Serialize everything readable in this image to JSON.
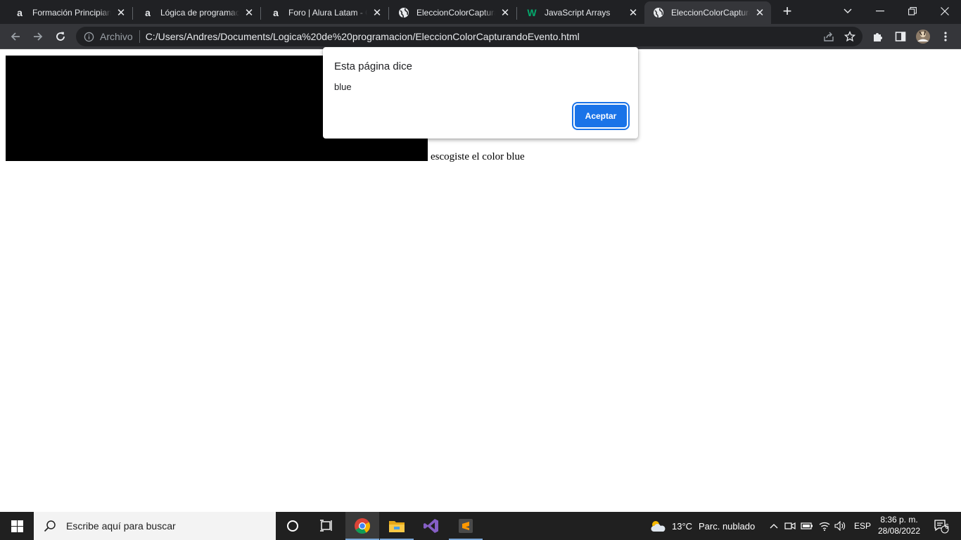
{
  "browser": {
    "tabs": [
      {
        "title": "Formación Principiante",
        "favicon": "alura-a-icon",
        "glyph": "a"
      },
      {
        "title": "Lógica de programación",
        "favicon": "alura-a-icon",
        "glyph": "a"
      },
      {
        "title": "Foro | Alura Latam - Cursos",
        "favicon": "alura-a-icon",
        "glyph": "a"
      },
      {
        "title": "EleccionColorCapturando",
        "favicon": "globe-icon",
        "glyph": ""
      },
      {
        "title": "JavaScript Arrays",
        "favicon": "w3schools-icon",
        "glyph": "W"
      },
      {
        "title": "EleccionColorCapturando",
        "favicon": "globe-icon",
        "glyph": "",
        "active": true
      }
    ],
    "new_tab": "+",
    "window_controls": {
      "tab_search": "⌄",
      "minimize": "—",
      "restore": "❐",
      "close": "✕"
    },
    "omnibox": {
      "chip": "Archivo",
      "url": "C:/Users/Andres/Documents/Logica%20de%20programacion/EleccionColorCapturandoEvento.html"
    }
  },
  "page": {
    "chosen_text": "escogiste el color blue"
  },
  "dialog": {
    "title": "Esta página dice",
    "message": "blue",
    "ok_label": "Aceptar"
  },
  "taskbar": {
    "search_placeholder": "Escribe aquí para buscar",
    "weather_temp": "13°C",
    "weather_desc": "Parc. nublado",
    "language": "ESP",
    "time": "8:36 p. m.",
    "date": "28/08/2022",
    "notifications_count": "6"
  },
  "colors": {
    "tab_strip": "#202124",
    "toolbar": "#35363a",
    "accent_blue": "#1a73e8",
    "taskbar": "#202020"
  }
}
